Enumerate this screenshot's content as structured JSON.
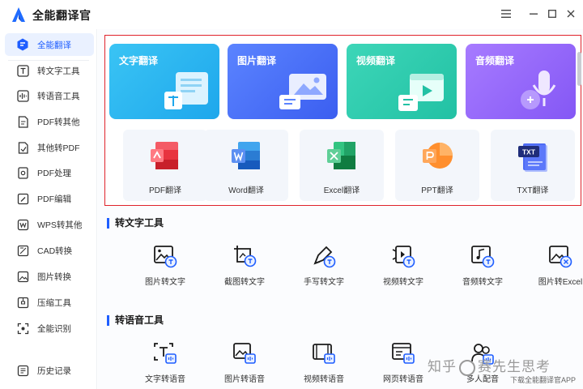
{
  "app": {
    "title": "全能翻译官"
  },
  "sidebar": {
    "items": [
      {
        "label": "全能翻译",
        "icon": "translate-hub-icon",
        "active": true
      },
      {
        "label": "转文字工具",
        "icon": "text-tool-icon"
      },
      {
        "label": "转语音工具",
        "icon": "voice-tool-icon"
      },
      {
        "label": "PDF转其他",
        "icon": "pdf-convert-icon"
      },
      {
        "label": "其他转PDF",
        "icon": "to-pdf-icon"
      },
      {
        "label": "PDF处理",
        "icon": "pdf-process-icon"
      },
      {
        "label": "PDF编辑",
        "icon": "pdf-edit-icon"
      },
      {
        "label": "WPS转其他",
        "icon": "wps-convert-icon"
      },
      {
        "label": "CAD转换",
        "icon": "cad-icon"
      },
      {
        "label": "图片转换",
        "icon": "image-convert-icon"
      },
      {
        "label": "压缩工具",
        "icon": "compress-icon"
      },
      {
        "label": "全能识别",
        "icon": "recognize-icon"
      },
      {
        "label": "历史记录",
        "icon": "history-icon"
      }
    ]
  },
  "featured": {
    "cards": [
      {
        "title": "文字翻译",
        "icon": "text-translate-icon"
      },
      {
        "title": "图片翻译",
        "icon": "image-translate-icon"
      },
      {
        "title": "视频翻译",
        "icon": "video-translate-icon"
      },
      {
        "title": "音频翻译",
        "icon": "audio-translate-icon"
      }
    ],
    "docs": [
      {
        "label": "PDF翻译",
        "icon": "pdf-icon"
      },
      {
        "label": "Word翻译",
        "icon": "word-icon"
      },
      {
        "label": "Excel翻译",
        "icon": "excel-icon"
      },
      {
        "label": "PPT翻译",
        "icon": "ppt-icon"
      },
      {
        "label": "TXT翻译",
        "icon": "txt-icon"
      }
    ]
  },
  "sections": {
    "to_text": {
      "title": "转文字工具",
      "tools": [
        {
          "label": "图片转文字"
        },
        {
          "label": "截图转文字"
        },
        {
          "label": "手写转文字"
        },
        {
          "label": "视频转文字"
        },
        {
          "label": "音频转文字"
        },
        {
          "label": "图片转Excel"
        }
      ]
    },
    "to_voice": {
      "title": "转语音工具",
      "tools": [
        {
          "label": "文字转语音"
        },
        {
          "label": "图片转语音"
        },
        {
          "label": "视频转语音"
        },
        {
          "label": "网页转语音"
        },
        {
          "label": "多人配音"
        }
      ]
    }
  },
  "watermark": {
    "text_left": "知乎",
    "text_right": "赛先生思考"
  },
  "footer": {
    "hint": "下载全能翻译官APP"
  },
  "colors": {
    "accent": "#1f5eff",
    "highlight_border": "#e0232b"
  }
}
